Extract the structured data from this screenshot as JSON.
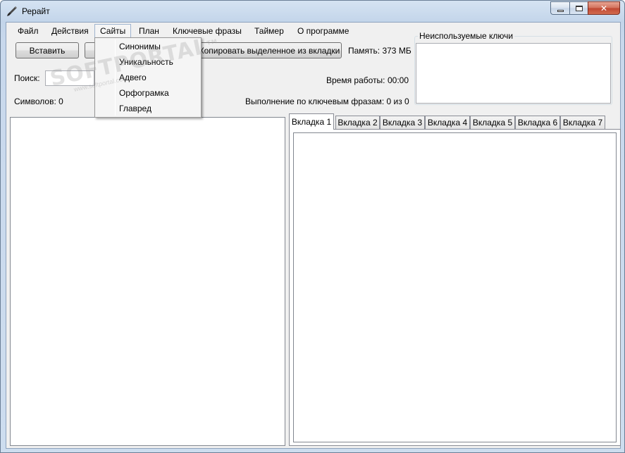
{
  "window": {
    "title": "Рерайт",
    "icon": "brush-icon",
    "caption": {
      "close_glyph": "✕"
    }
  },
  "menubar": {
    "items": [
      "Файл",
      "Действия",
      "Сайты",
      "План",
      "Ключевые фразы",
      "Таймер",
      "О программе"
    ]
  },
  "sites_menu": {
    "items": [
      "Синонимы",
      "Уникальность",
      "Адвего",
      "Орфограмка",
      "Главред"
    ]
  },
  "toolbar": {
    "paste_label": "Вставить",
    "copy_from_tab_label": "Копировать выделенное из вкладки",
    "memory_text": "Память: 373 МБ"
  },
  "search": {
    "label": "Поиск:",
    "value": ""
  },
  "stats": {
    "chars_text": "Символов: 0",
    "work_time_label": "Время работы:",
    "work_time_value": "00:00",
    "keyphrase_progress": "Выполнение по ключевым фразам: 0 из 0"
  },
  "unused_keys": {
    "title": "Неиспользуемые ключи"
  },
  "tabs": [
    "Вкладка 1",
    "Вкладка 2",
    "Вкладка 3",
    "Вкладка 4",
    "Вкладка 5",
    "Вкладка 6",
    "Вкладка 7"
  ],
  "active_tab": 0,
  "watermark": {
    "main": "SOFTPORTAL",
    "sub": "www.softportal.com",
    "mark": "TM"
  },
  "colors": {
    "frame": "#c3d5ea",
    "client": "#f0f0f0",
    "close_button": "#c8503a"
  }
}
